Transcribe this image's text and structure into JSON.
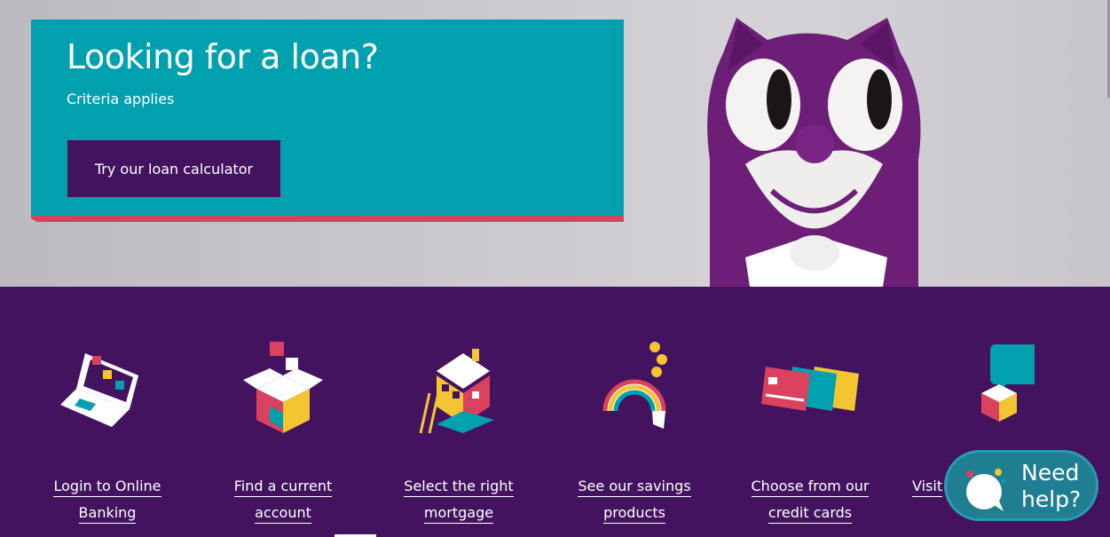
{
  "hero": {
    "title": "Looking for a loan?",
    "subtitle": "Criteria applies",
    "cta_label": "Try our loan calculator",
    "card_color": "#00a0ae",
    "accent_color": "#d9415f"
  },
  "services": {
    "items": [
      {
        "icon": "laptop-icon",
        "line1": "Login to Online",
        "line2": "Banking"
      },
      {
        "icon": "box-icon",
        "line1": "Find a current",
        "line2": "account"
      },
      {
        "icon": "house-icon",
        "line1": "Select the right",
        "line2": "mortgage"
      },
      {
        "icon": "rainbow-piggybank-icon",
        "line1": "See our savings",
        "line2": "products"
      },
      {
        "icon": "credit-cards-icon",
        "line1": "Choose from our",
        "line2": "credit cards"
      },
      {
        "icon": "chat-bubble-icon",
        "line1": "Visit",
        "line2": ""
      }
    ],
    "background": "#44135f"
  },
  "help": {
    "line1": "Need",
    "line2": "help?",
    "color": "#1f7e92"
  }
}
